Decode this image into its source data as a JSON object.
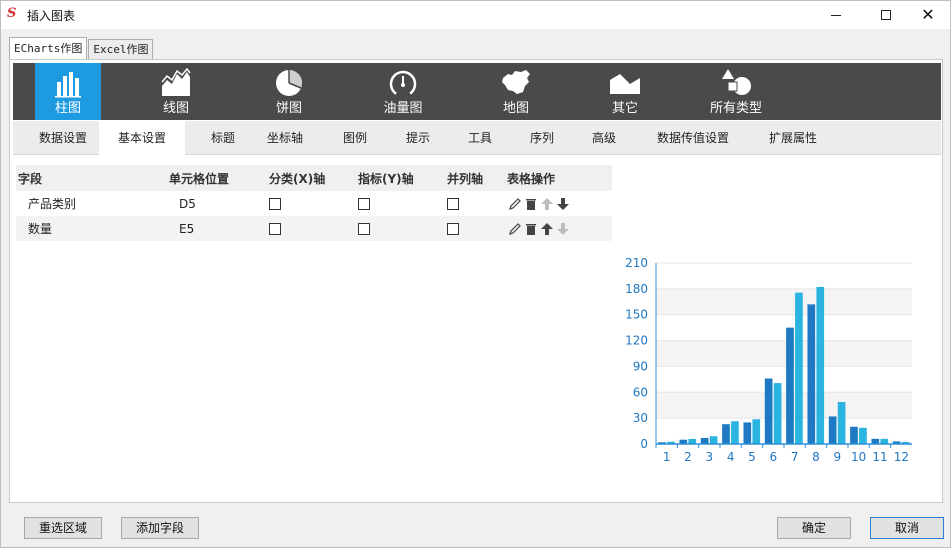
{
  "window": {
    "title": "插入图表"
  },
  "top_tabs": [
    {
      "label": "ECharts作图"
    },
    {
      "label": "Excel作图"
    }
  ],
  "chart_types": [
    {
      "label": "柱图",
      "icon": "bar-chart-icon"
    },
    {
      "label": "线图",
      "icon": "line-chart-icon"
    },
    {
      "label": "饼图",
      "icon": "pie-chart-icon"
    },
    {
      "label": "油量图",
      "icon": "gauge-icon"
    },
    {
      "label": "地图",
      "icon": "map-icon"
    },
    {
      "label": "其它",
      "icon": "area-icon"
    },
    {
      "label": "所有类型",
      "icon": "shapes-icon"
    }
  ],
  "sub_tabs": [
    {
      "label": "数据设置"
    },
    {
      "label": "基本设置"
    },
    {
      "label": "标题"
    },
    {
      "label": "坐标轴"
    },
    {
      "label": "图例"
    },
    {
      "label": "提示"
    },
    {
      "label": "工具"
    },
    {
      "label": "序列"
    },
    {
      "label": "高级"
    },
    {
      "label": "数据传值设置"
    },
    {
      "label": "扩展属性"
    }
  ],
  "grid": {
    "headers": {
      "field": "字段",
      "cell": "单元格位置",
      "xaxis": "分类(X)轴",
      "yaxis": "指标(Y)轴",
      "series": "并列轴",
      "ops": "表格操作"
    },
    "rows": [
      {
        "field": "产品类别",
        "cell": "D5",
        "xaxis": false,
        "yaxis": false,
        "series": false
      },
      {
        "field": "数量",
        "cell": "E5",
        "xaxis": false,
        "yaxis": false,
        "series": false
      }
    ]
  },
  "chart_data": {
    "type": "bar",
    "categories": [
      "1",
      "2",
      "3",
      "4",
      "5",
      "6",
      "7",
      "8",
      "9",
      "10",
      "11",
      "12"
    ],
    "series": [
      {
        "values": [
          2,
          5,
          7,
          23,
          25,
          76,
          135,
          162,
          32,
          20,
          6,
          3
        ]
      },
      {
        "values": [
          2.6,
          5.9,
          9,
          26.4,
          28.7,
          70.7,
          175.6,
          182.2,
          48.7,
          18.8,
          6,
          2.3
        ]
      }
    ],
    "y_ticks": [
      "0",
      "30",
      "60",
      "90",
      "120",
      "150",
      "180",
      "210"
    ],
    "ylim": [
      0,
      210
    ],
    "colors": [
      "#1f78c4",
      "#2bb4e0"
    ],
    "grid": true
  },
  "buttons": {
    "reselect": "重选区域",
    "add_field": "添加字段",
    "ok": "确定",
    "cancel": "取消"
  },
  "colors": {
    "accent": "#1e9be0",
    "toolbar_bg": "#4a4a4a"
  }
}
